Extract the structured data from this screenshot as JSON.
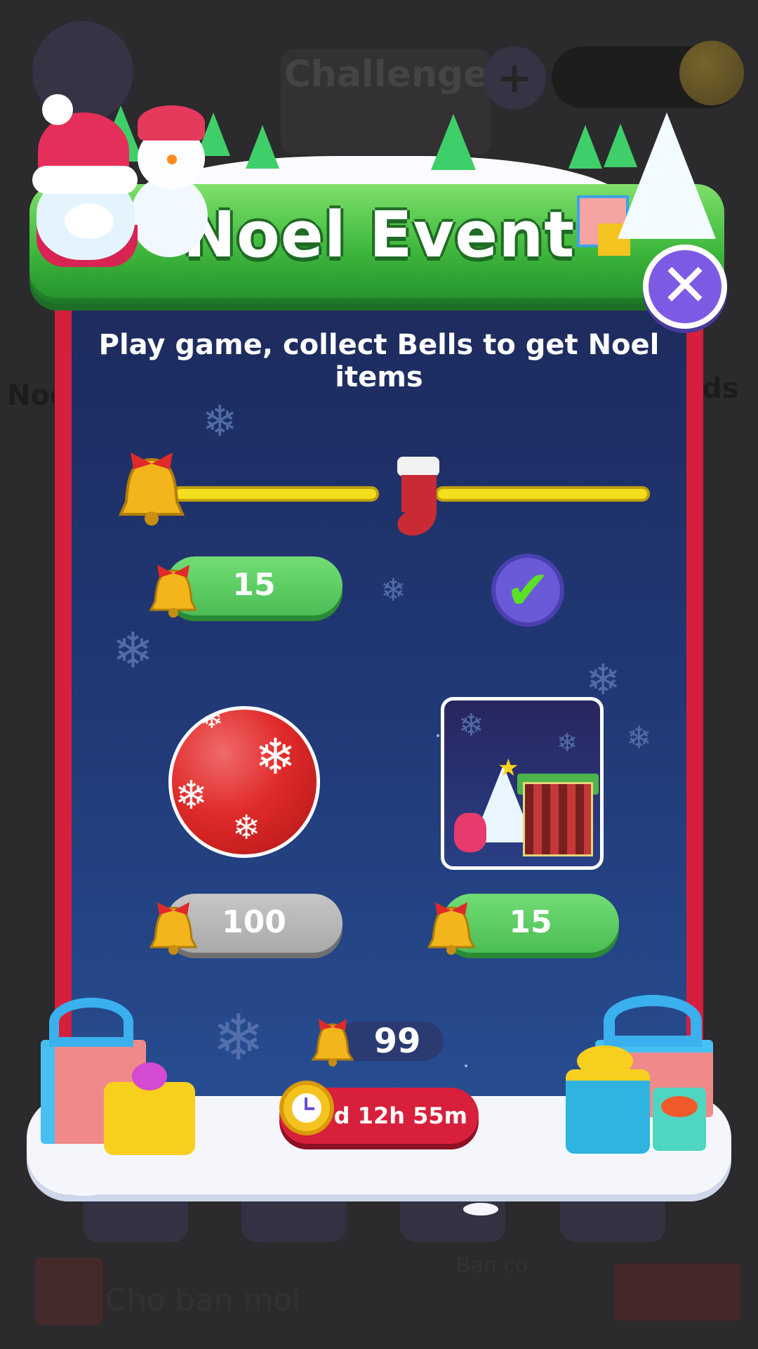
{
  "background": {
    "title": "Challenge",
    "side_left_text": "Noc",
    "side_right_text": "ds",
    "bottom_text": "Cho ban moi",
    "bottom_right_text": "Ban co"
  },
  "event": {
    "title": "Noel Event",
    "subtitle": "Play game, collect Bells to get Noel items",
    "close_icon": "close-icon",
    "rewards": [
      {
        "item": "stocking",
        "cost": "15",
        "state": "claimed",
        "track_icon": "bell-icon"
      },
      {
        "item": "red-ornament-ball",
        "cost": "100",
        "state": "locked"
      },
      {
        "item": "christmas-scene-card",
        "cost": "15",
        "state": "available"
      }
    ],
    "bell_count": "99",
    "timer": "29d 12h 55m"
  },
  "colors": {
    "banner_green": "#3fb83d",
    "panel_red": "#d61f3c",
    "panel_blue": "#213a78",
    "button_green": "#4cbd55",
    "button_gray": "#a9a9a9",
    "close_purple": "#7d5ae4",
    "track_yellow": "#f3df1e"
  },
  "icons": {
    "currency": "bell-icon",
    "settings": "gear-icon",
    "add": "plus-icon",
    "coin": "coin-icon",
    "claimed": "checkmark-icon",
    "timer": "alarm-clock-icon"
  }
}
